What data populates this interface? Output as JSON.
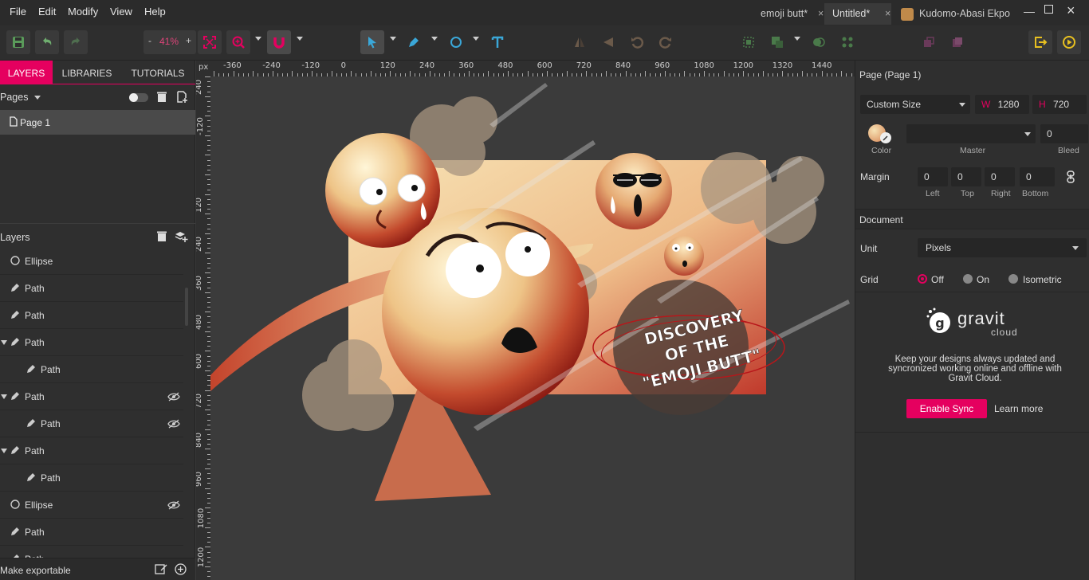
{
  "menu": [
    "File",
    "Edit",
    "Modify",
    "View",
    "Help"
  ],
  "tabs": [
    {
      "label": "emoji butt*",
      "active": false
    },
    {
      "label": "Untitled*",
      "active": true
    },
    {
      "label": "Kudomo-Abasi Ekpo",
      "active": false
    }
  ],
  "toolbar": {
    "zoom_minus": "-",
    "zoom_value": "41%",
    "zoom_plus": "+"
  },
  "left": {
    "tabs": [
      "LAYERS",
      "LIBRARIES",
      "TUTORIALS"
    ],
    "pages_label": "Pages",
    "page1": "Page 1",
    "layers_label": "Layers",
    "layers": [
      {
        "label": "Ellipse",
        "indent": 0,
        "icon": "ellipse",
        "expand": false,
        "hidden": false
      },
      {
        "label": "Path",
        "indent": 0,
        "icon": "pen",
        "expand": false,
        "hidden": false
      },
      {
        "label": "Path",
        "indent": 0,
        "icon": "pen",
        "expand": false,
        "hidden": false
      },
      {
        "label": "Path",
        "indent": 0,
        "icon": "pen",
        "expand": true,
        "hidden": false
      },
      {
        "label": "Path",
        "indent": 1,
        "icon": "pen",
        "expand": false,
        "hidden": false
      },
      {
        "label": "Path",
        "indent": 0,
        "icon": "pen",
        "expand": true,
        "hidden": true
      },
      {
        "label": "Path",
        "indent": 1,
        "icon": "pen",
        "expand": false,
        "hidden": true
      },
      {
        "label": "Path",
        "indent": 0,
        "icon": "pen",
        "expand": true,
        "hidden": false
      },
      {
        "label": "Path",
        "indent": 1,
        "icon": "pen",
        "expand": false,
        "hidden": false
      },
      {
        "label": "Ellipse",
        "indent": 0,
        "icon": "ellipse",
        "expand": false,
        "hidden": true
      },
      {
        "label": "Path",
        "indent": 0,
        "icon": "pen",
        "expand": false,
        "hidden": false
      },
      {
        "label": "Path",
        "indent": 0,
        "icon": "pen",
        "expand": false,
        "hidden": false
      }
    ],
    "make_exportable": "Make exportable"
  },
  "ruler": {
    "unit": "px",
    "h_ticks": [
      "-360",
      "-240",
      "-120",
      "0",
      "120",
      "240",
      "360",
      "480",
      "600",
      "720",
      "840",
      "960",
      "1080",
      "1200",
      "1320",
      "1440"
    ],
    "v_ticks": [
      "240",
      "-120",
      "0",
      "120",
      "240",
      "360",
      "480",
      "600",
      "720",
      "840",
      "960",
      "1080",
      "1200"
    ]
  },
  "artwork": {
    "line1": "DISCOVERY",
    "line2": "OF THE",
    "line3": "\"EMOJI BUTT\""
  },
  "right": {
    "page_title": "Page (Page 1)",
    "size_preset": "Custom Size",
    "w_label": "W",
    "w_value": "1280",
    "h_label": "H",
    "h_value": "720",
    "color_label": "Color",
    "master_label": "Master",
    "bleed_value": "0",
    "bleed_label": "Bleed",
    "margin_label": "Margin",
    "margins": [
      {
        "value": "0",
        "label": "Left"
      },
      {
        "value": "0",
        "label": "Top"
      },
      {
        "value": "0",
        "label": "Right"
      },
      {
        "value": "0",
        "label": "Bottom"
      }
    ],
    "document_label": "Document",
    "unit_label": "Unit",
    "unit_value": "Pixels",
    "grid_label": "Grid",
    "grid_options": [
      "Off",
      "On",
      "Isometric"
    ],
    "cloud_brand": "gravit",
    "cloud_sub": "cloud",
    "cloud_text": "Keep your designs always updated and syncronized working online and offline with Gravit Cloud.",
    "enable_sync": "Enable Sync",
    "learn_more": "Learn more"
  },
  "colors": {
    "accent": "#e5005f",
    "canvas_bg": "#3b3b3b",
    "panel_bg": "#2f2f2f"
  }
}
